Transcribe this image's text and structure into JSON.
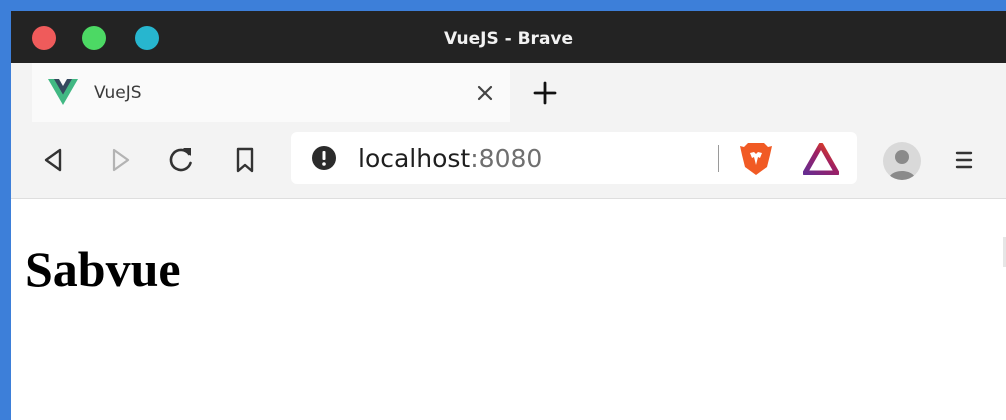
{
  "window": {
    "title": "VueJS - Brave"
  },
  "tab": {
    "title": "VueJS",
    "favicon": "vue-logo-icon"
  },
  "toolbar": {
    "back_icon": "back-arrow-icon",
    "forward_icon": "forward-arrow-icon",
    "reload_icon": "reload-icon",
    "bookmark_icon": "bookmark-icon",
    "menu_icon": "hamburger-menu-icon"
  },
  "address_bar": {
    "host": "localhost",
    "port": ":8080",
    "site_info_icon": "info-icon"
  },
  "extensions": {
    "shield_icon": "brave-shield-icon",
    "rewards_icon": "brave-rewards-icon"
  },
  "page": {
    "heading": "Sabvue"
  },
  "colors": {
    "desktop_bg": "#3d7fd9",
    "titlebar_bg": "#232323",
    "close": "#ef5b5b",
    "minimize": "#4cd964",
    "maximize": "#27b6cf",
    "vue_green": "#41b883",
    "vue_dark": "#34495e",
    "brave_orange": "#f15a24"
  }
}
